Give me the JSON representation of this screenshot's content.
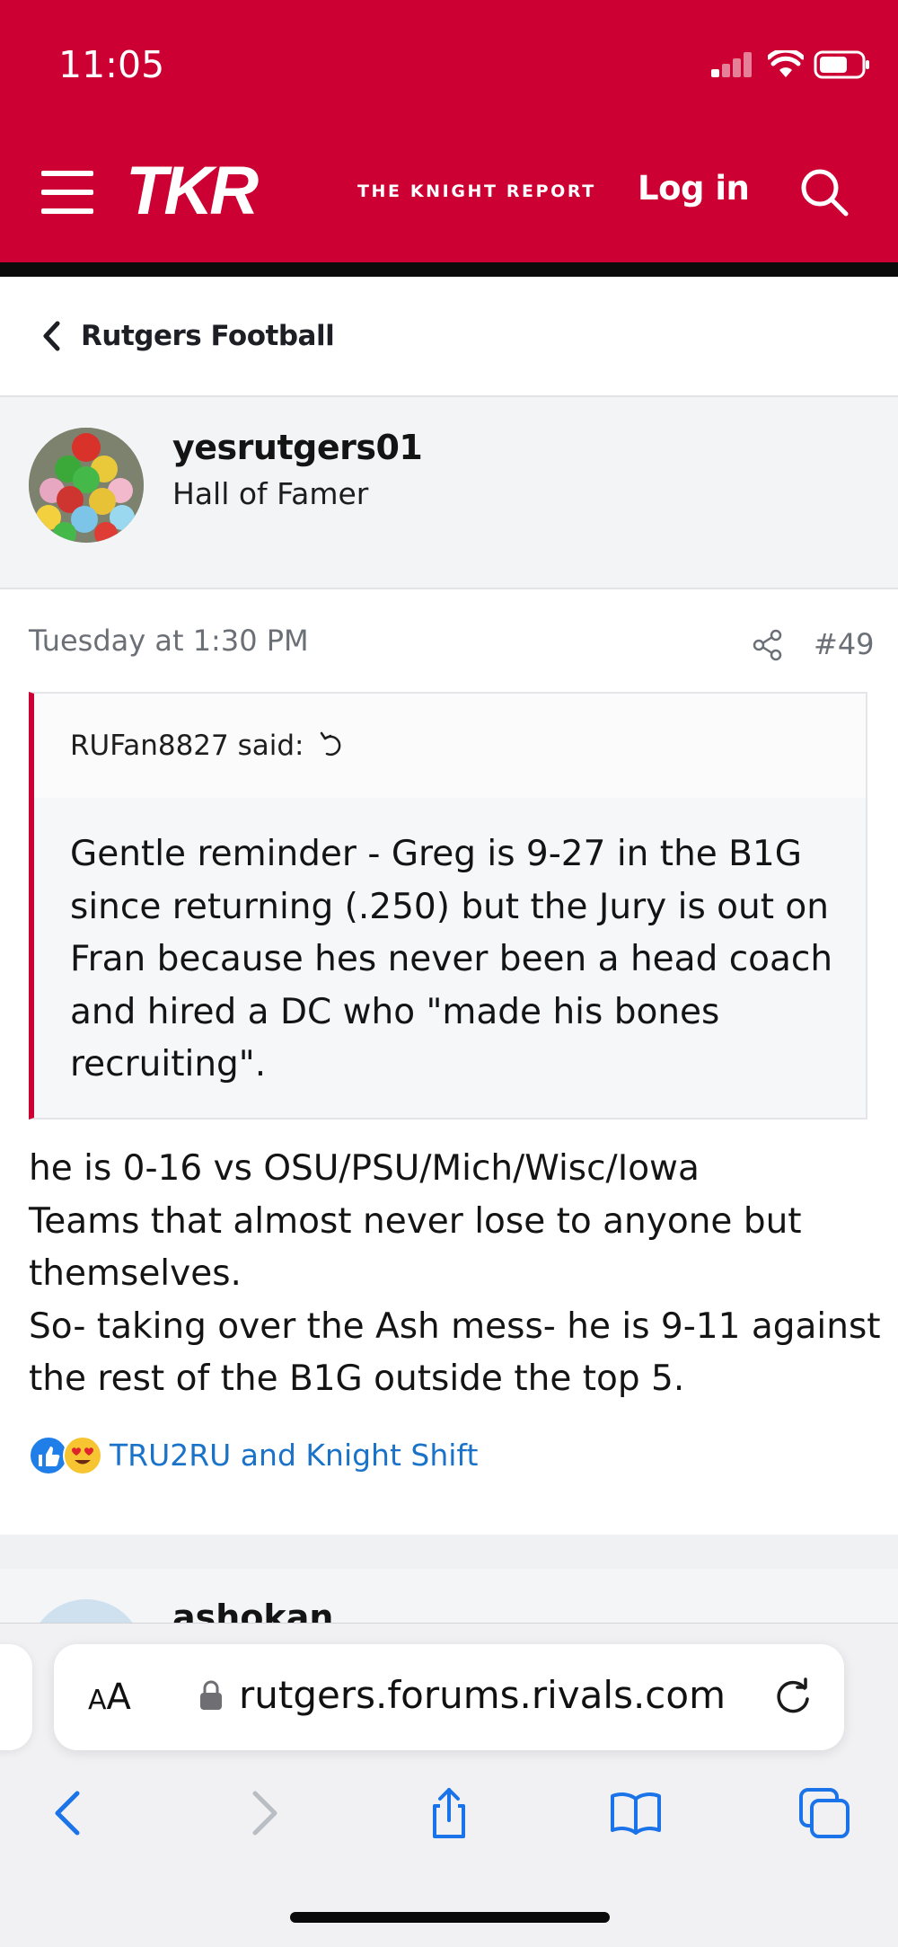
{
  "status_bar": {
    "time": "11:05"
  },
  "header": {
    "logo_text": "TKR",
    "logo_subtitle": "THE KNIGHT REPORT",
    "login_label": "Log in",
    "brand_color": "#cc0033"
  },
  "breadcrumb": {
    "label": "Rutgers Football"
  },
  "user": {
    "name": "yesrutgers01",
    "title": "Hall of Famer"
  },
  "post": {
    "date": "Tuesday at 1:30 PM",
    "number": "#49",
    "quote": {
      "author": "RUFan8827 said:",
      "text": "Gentle reminder - Greg is 9-27 in the B1G since returning (.250) but the Jury is out on Fran because hes never been a head coach and hired a DC who \"made his bones recruiting\"."
    },
    "body": [
      "he is 0-16 vs OSU/PSU/Mich/Wisc/Iowa",
      "Teams that almost never lose to anyone but themselves.",
      "So- taking over the Ash mess- he is 9-11 against the rest of the B1G outside the top 5."
    ],
    "reactions": {
      "icons": [
        "like-icon",
        "love-icon"
      ],
      "users": "TRU2RU and Knight Shift"
    }
  },
  "next_post": {
    "user_name": "ashokan"
  },
  "browser": {
    "aa_label_small": "A",
    "aa_label_large": "A",
    "url": "rutgers.forums.rivals.com",
    "nav_icons": [
      "back-icon",
      "forward-icon",
      "share-icon",
      "bookmarks-icon",
      "tabs-icon"
    ]
  }
}
